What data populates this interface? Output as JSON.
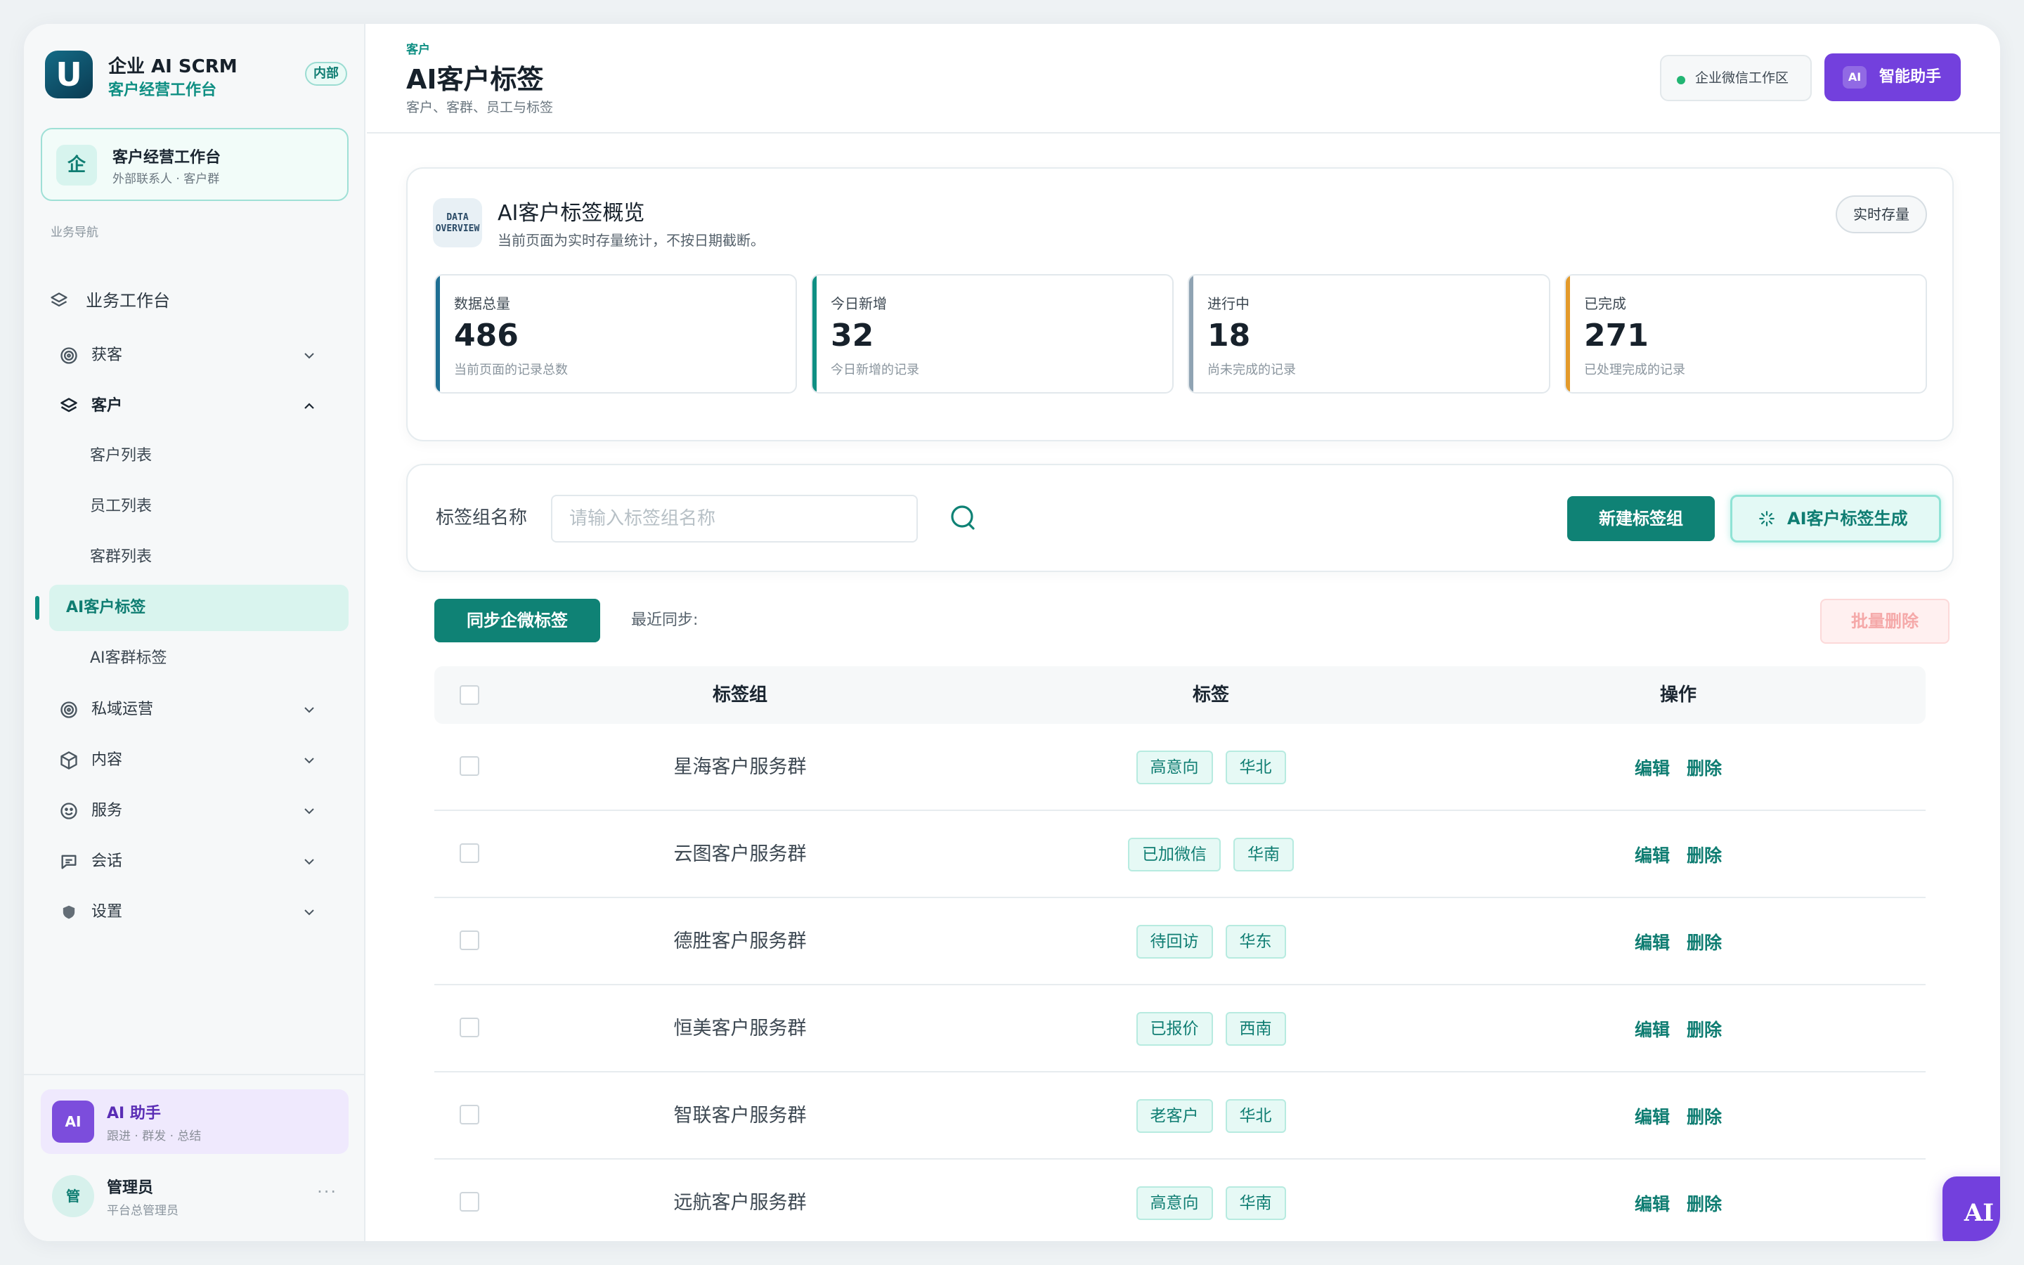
{
  "brand": {
    "title": "企业 AI SCRM",
    "subtitle": "客户经营工作台",
    "badge": "内部",
    "logo_letter": "U"
  },
  "workspace": {
    "icon_char": "企",
    "title": "客户经营工作台",
    "subtitle": "外部联系人 · 客户群"
  },
  "nav": {
    "section": "业务导航",
    "top": {
      "label": "业务工作台",
      "icon": "layers-icon"
    },
    "groups": [
      {
        "label": "获客",
        "icon": "target-icon",
        "expanded": false
      },
      {
        "label": "客户",
        "icon": "layers-icon",
        "expanded": true
      },
      {
        "label": "私域运营",
        "icon": "target-icon",
        "expanded": false
      },
      {
        "label": "内容",
        "icon": "cube-icon",
        "expanded": false
      },
      {
        "label": "服务",
        "icon": "smile-icon",
        "expanded": false
      },
      {
        "label": "会话",
        "icon": "chat-icon",
        "expanded": false
      },
      {
        "label": "设置",
        "icon": "shield-icon",
        "expanded": false
      }
    ],
    "customer_items": [
      "客户列表",
      "员工列表",
      "客群列表",
      "AI客户标签",
      "AI客群标签"
    ],
    "active_item": "AI客户标签"
  },
  "ai_card": {
    "avatar": "AI",
    "title": "AI 助手",
    "subtitle": "跟进 · 群发 · 总结"
  },
  "user": {
    "avatar": "管",
    "name": "管理员",
    "role": "平台总管理员",
    "more": "···"
  },
  "header": {
    "breadcrumb": "客户",
    "title": "AI客户标签",
    "subtitle": "客户、客群、员工与标签",
    "workspace_label": "企业微信工作区",
    "assistant_chip": "AI",
    "assistant_label": "智能助手"
  },
  "overview": {
    "icon_text_1": "DATA",
    "icon_text_2": "OVERVIEW",
    "title": "AI客户标签概览",
    "subtitle": "当前页面为实时存量统计，不按日期截断。",
    "tag": "实时存量",
    "stats": [
      {
        "label": "数据总量",
        "value": "486",
        "desc": "当前页面的记录总数",
        "color": "#1f6f93"
      },
      {
        "label": "今日新增",
        "value": "32",
        "desc": "今日新增的记录",
        "color": "#0f8f83"
      },
      {
        "label": "进行中",
        "value": "18",
        "desc": "尚未完成的记录",
        "color": "#8fa3b3"
      },
      {
        "label": "已完成",
        "value": "271",
        "desc": "已处理完成的记录",
        "color": "#e39a2b"
      }
    ]
  },
  "search": {
    "label": "标签组名称",
    "placeholder": "请输入标签组名称",
    "value": "",
    "new_button": "新建标签组",
    "ai_button": "AI客户标签生成"
  },
  "toolbar": {
    "sync_button": "同步企微标签",
    "last_sync_label": "最近同步:",
    "bulk_delete": "批量删除"
  },
  "table": {
    "columns": [
      "标签组",
      "标签",
      "操作"
    ],
    "rows": [
      {
        "name": "星海客户服务群",
        "tags": [
          "高意向",
          "华北"
        ]
      },
      {
        "name": "云图客户服务群",
        "tags": [
          "已加微信",
          "华南"
        ]
      },
      {
        "name": "德胜客户服务群",
        "tags": [
          "待回访",
          "华东"
        ]
      },
      {
        "name": "恒美客户服务群",
        "tags": [
          "已报价",
          "西南"
        ]
      },
      {
        "name": "智联客户服务群",
        "tags": [
          "老客户",
          "华北"
        ]
      },
      {
        "name": "远航客户服务群",
        "tags": [
          "高意向",
          "华南"
        ]
      }
    ],
    "edit_label": "编辑",
    "delete_label": "删除"
  },
  "fab": {
    "label": "AI"
  },
  "colors": {
    "primary": "#0f8275",
    "accent_purple": "#7340dd",
    "active_bg": "#d9f4ee"
  }
}
